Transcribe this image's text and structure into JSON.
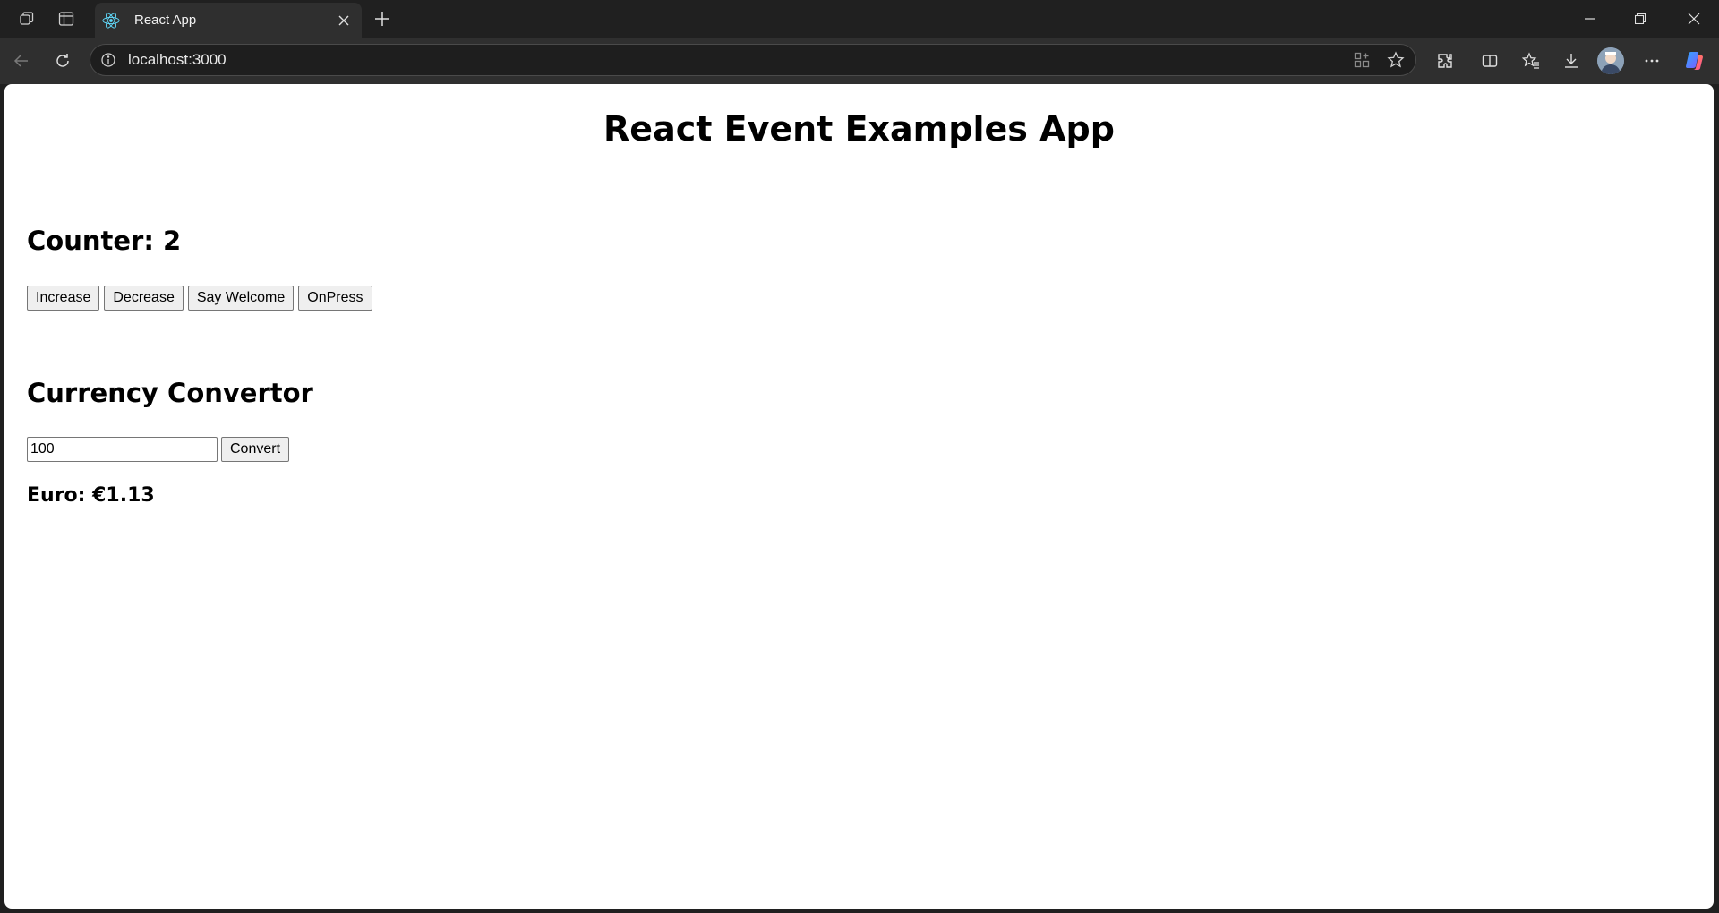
{
  "browser": {
    "tab": {
      "title": "React App"
    },
    "address_bar": {
      "url": "localhost:3000"
    }
  },
  "page": {
    "title": "React Event Examples App",
    "counter": {
      "heading_prefix": "Counter: ",
      "value": "2",
      "buttons": {
        "increase": "Increase",
        "decrease": "Decrease",
        "say_welcome": "Say Welcome",
        "onpress": "OnPress"
      }
    },
    "currency": {
      "heading": "Currency Convertor",
      "amount_value": "100",
      "convert_label": "Convert",
      "result_text": "Euro: €1.13"
    }
  },
  "colors": {
    "chrome_dark": "#202020",
    "toolbar": "#2f2f2f",
    "page_bg": "#ffffff",
    "react_blue": "#61dafb"
  }
}
